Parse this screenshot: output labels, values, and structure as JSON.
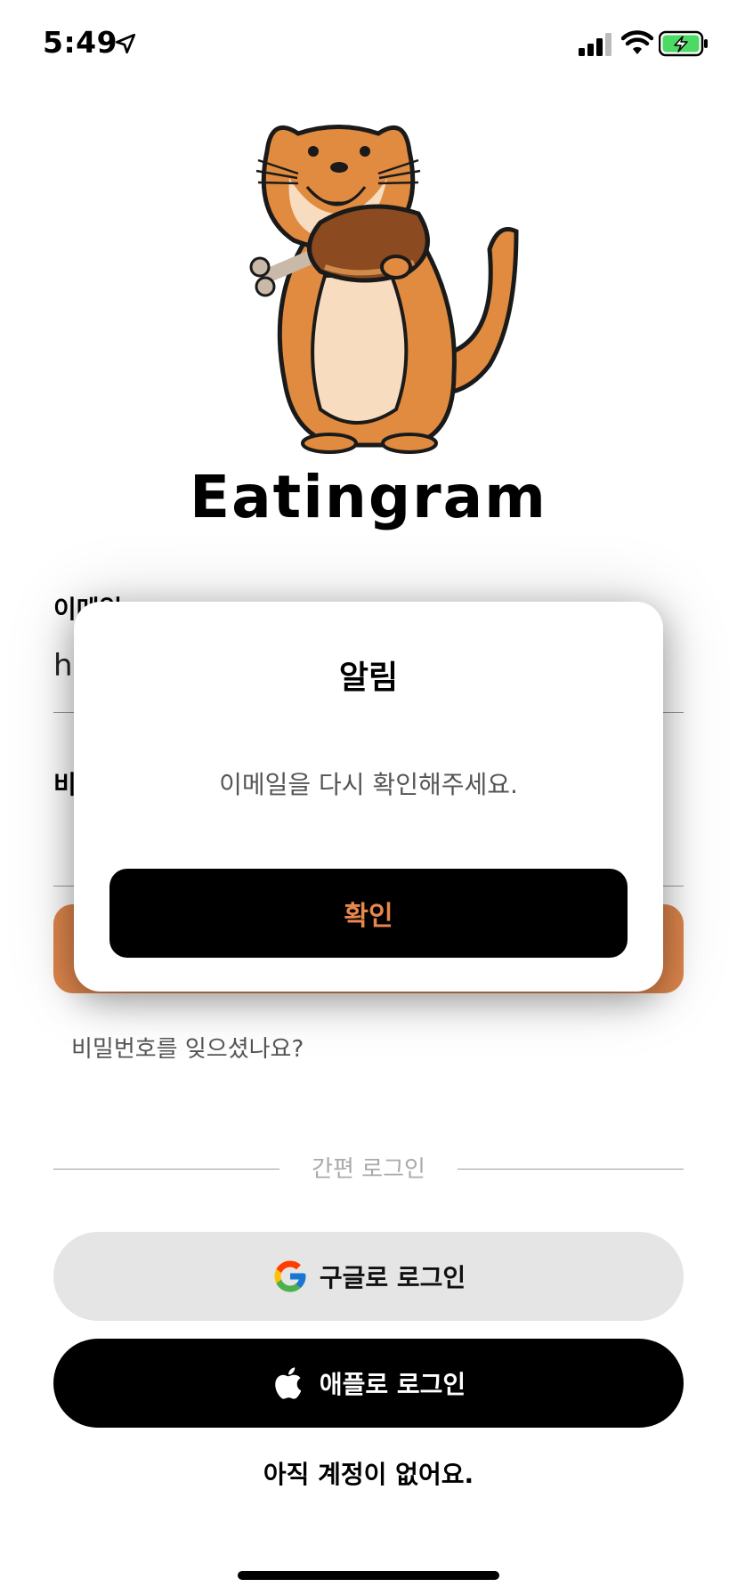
{
  "status": {
    "time": "5:49"
  },
  "brand": {
    "name": "Eatingram"
  },
  "form": {
    "email_label": "이메일",
    "email_value": "ha",
    "password_label": "비밀번호",
    "forgot_link": "비밀번호를 잊으셨나요?"
  },
  "simple_login": {
    "divider_label": "간편 로그인",
    "google_label": "구글로 로그인",
    "apple_label": "애플로 로그인"
  },
  "signup": {
    "label": "아직 계정이 없어요."
  },
  "alert": {
    "title": "알림",
    "message": "이메일을 다시 확인해주세요.",
    "confirm_label": "확인"
  },
  "colors": {
    "accent": "#e0874d",
    "battery": "#4cd964"
  },
  "icons": {
    "location": "location-arrow-icon",
    "signal": "cellular-signal-icon",
    "wifi": "wifi-icon",
    "battery": "battery-charging-icon",
    "google": "google-logo-icon",
    "apple": "apple-logo-icon"
  }
}
